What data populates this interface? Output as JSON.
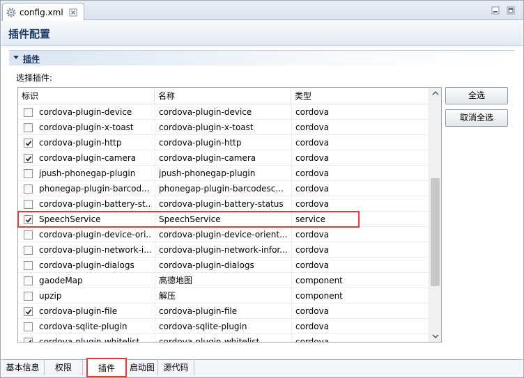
{
  "editor": {
    "tab_label": "config.xml",
    "tab_icon": "gear-icon",
    "close_icon": "close-icon"
  },
  "form": {
    "title": "插件配置",
    "section_title": "插件",
    "select_label": "选择插件:"
  },
  "table": {
    "headers": [
      "标识",
      "名称",
      "类型"
    ],
    "rows": [
      {
        "checked": false,
        "id": "cordova-plugin-device",
        "name": "cordova-plugin-device",
        "type": "cordova"
      },
      {
        "checked": false,
        "id": "cordova-plugin-x-toast",
        "name": "cordova-plugin-x-toast",
        "type": "cordova"
      },
      {
        "checked": true,
        "id": "cordova-plugin-http",
        "name": "cordova-plugin-http",
        "type": "cordova"
      },
      {
        "checked": true,
        "id": "cordova-plugin-camera",
        "name": "cordova-plugin-camera",
        "type": "cordova"
      },
      {
        "checked": false,
        "id": "jpush-phonegap-plugin",
        "name": "jpush-phonegap-plugin",
        "type": "cordova"
      },
      {
        "checked": false,
        "id": "phonegap-plugin-barcod...",
        "name": "phonegap-plugin-barcodesc...",
        "type": "cordova"
      },
      {
        "checked": false,
        "id": "cordova-plugin-battery-st...",
        "name": "cordova-plugin-battery-status",
        "type": "cordova"
      },
      {
        "checked": true,
        "id": "SpeechService",
        "name": "SpeechService",
        "type": "service"
      },
      {
        "checked": false,
        "id": "cordova-plugin-device-ori...",
        "name": "cordova-plugin-device-orient...",
        "type": "cordova"
      },
      {
        "checked": false,
        "id": "cordova-plugin-network-i...",
        "name": "cordova-plugin-network-infor...",
        "type": "cordova"
      },
      {
        "checked": false,
        "id": "cordova-plugin-dialogs",
        "name": "cordova-plugin-dialogs",
        "type": "cordova"
      },
      {
        "checked": false,
        "id": "gaodeMap",
        "name": "高德地图",
        "type": "component"
      },
      {
        "checked": false,
        "id": "upzip",
        "name": "解压",
        "type": "component"
      },
      {
        "checked": true,
        "id": "cordova-plugin-file",
        "name": "cordova-plugin-file",
        "type": "cordova"
      },
      {
        "checked": false,
        "id": "cordova-sqlite-plugin",
        "name": "cordova-sqlite-plugin",
        "type": "cordova"
      },
      {
        "checked": true,
        "id": "cordova-plugin-whitelist",
        "name": "cordova-plugin-whitelist",
        "type": "cordova"
      }
    ]
  },
  "buttons": {
    "select_all": "全选",
    "deselect_all": "取消全选"
  },
  "page_tabs": [
    "基本信息",
    "权限",
    "插件",
    "启动图",
    "源代码"
  ],
  "active_page_tab": "插件",
  "colors": {
    "highlight": "#e03b3b",
    "title": "#1c3a63"
  }
}
